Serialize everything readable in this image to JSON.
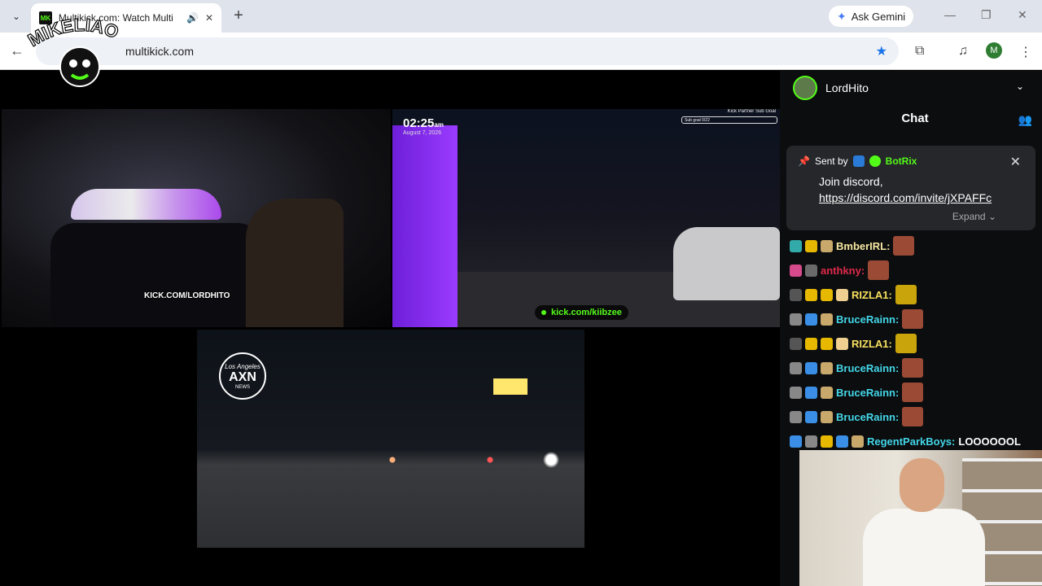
{
  "browser": {
    "tab_title": "Multikick.com: Watch Multi",
    "favicon_text": "MK",
    "url": "multikick.com",
    "gemini_label": "Ask Gemini",
    "profile_initial": "M"
  },
  "streams": {
    "s1": {
      "tag": "KICK.COM/LORDHITO"
    },
    "s2": {
      "time": "02:25",
      "ampm": "am",
      "date": "August 7, 2026",
      "goal_label": "Kick Partner Sub Goal",
      "goal_text": "Sub goal 0/22",
      "kick_tag": "kick.com/kiibzee"
    },
    "s3": {
      "logo_top": "Los Angeles",
      "logo_main": "AXN",
      "logo_bottom": "NEWS"
    }
  },
  "chat": {
    "channel": "LordHito",
    "title": "Chat",
    "pinned": {
      "sent_by": "Sent by",
      "bot": "BotRix",
      "text": "Join discord,",
      "link": "https://discord.com/invite/jXPAFFc",
      "expand": "Expand"
    },
    "messages": [
      {
        "user": "BmberIRL:",
        "color": "#f5e7a0",
        "badges": [
          "#3aa",
          "#e6b800",
          "#c9a86b"
        ]
      },
      {
        "user": "anthkny:",
        "color": "#e0294a",
        "badges": [
          "#d44a8a",
          "#6a6a6a"
        ]
      },
      {
        "user": "RIZLA1:",
        "color": "#f6e05e",
        "badges": [
          "#555",
          "#e6b800",
          "#e6b800",
          "#f0d090"
        ]
      },
      {
        "user": "BruceRainn:",
        "color": "#43d7e8",
        "badges": [
          "#888",
          "#3a8ee6",
          "#c9a86b"
        ]
      },
      {
        "user": "RIZLA1:",
        "color": "#f6e05e",
        "badges": [
          "#555",
          "#e6b800",
          "#e6b800",
          "#f0d090"
        ]
      },
      {
        "user": "BruceRainn:",
        "color": "#43d7e8",
        "badges": [
          "#888",
          "#3a8ee6",
          "#c9a86b"
        ]
      },
      {
        "user": "BruceRainn:",
        "color": "#43d7e8",
        "badges": [
          "#888",
          "#3a8ee6",
          "#c9a86b"
        ]
      },
      {
        "user": "BruceRainn:",
        "color": "#43d7e8",
        "badges": [
          "#888",
          "#3a8ee6",
          "#c9a86b"
        ]
      },
      {
        "user": "RegentParkBoys:",
        "color": "#43d7e8",
        "badges": [
          "#3a8ee6",
          "#888",
          "#e6b800",
          "#3a8ee6",
          "#c9a86b"
        ],
        "text": "LOOOOOOL"
      }
    ]
  },
  "overlay": {
    "logo_text": "MIKELIAO"
  }
}
